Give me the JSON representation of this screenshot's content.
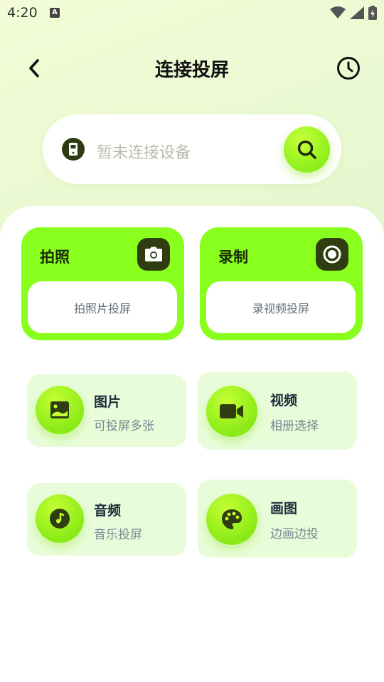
{
  "status_bar": {
    "time": "4:20",
    "notif_letter": "A"
  },
  "header": {
    "title": "连接投屏"
  },
  "search": {
    "placeholder": "暂未连接设备"
  },
  "big_cards": [
    {
      "title": "拍照",
      "action": "拍照片投屏",
      "icon": "camera-icon"
    },
    {
      "title": "录制",
      "action": "录视频投屏",
      "icon": "record-icon"
    }
  ],
  "small_cards": [
    {
      "title": "图片",
      "subtitle": "可投屏多张",
      "icon": "image-icon"
    },
    {
      "title": "视频",
      "subtitle": "相册选择",
      "icon": "video-icon"
    },
    {
      "title": "音频",
      "subtitle": "音乐投屏",
      "icon": "music-icon"
    },
    {
      "title": "画图",
      "subtitle": "边画边投",
      "icon": "palette-icon"
    }
  ],
  "colors": {
    "accent": "#88ff1c",
    "icon_dark": "#2f3d10",
    "card_light": "#e8fcd9"
  }
}
